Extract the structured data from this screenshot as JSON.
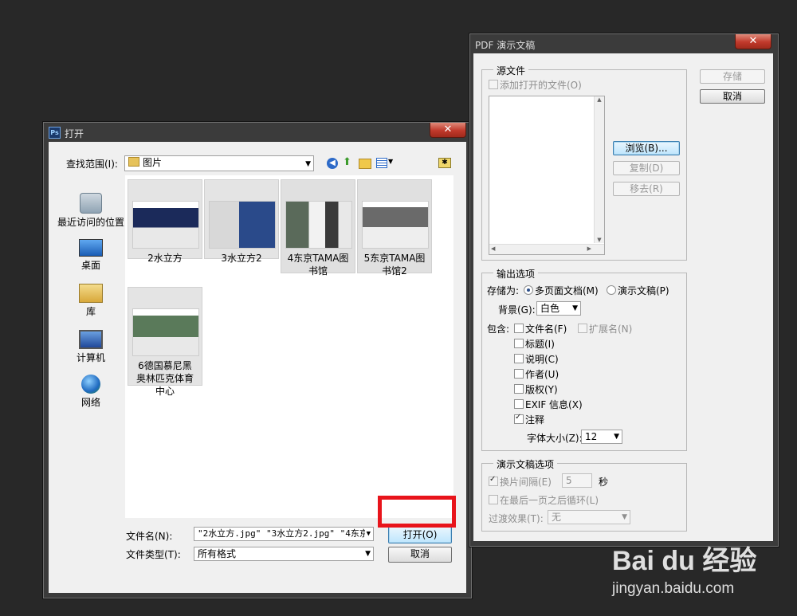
{
  "open_dialog": {
    "title": "打开",
    "close_label": "✕",
    "lookin_label": "查找范围(I):",
    "lookin_value": "图片",
    "places": [
      {
        "label": "最近访问的位置",
        "icon": "recent-places-icon"
      },
      {
        "label": "桌面",
        "icon": "desktop-icon"
      },
      {
        "label": "库",
        "icon": "library-icon"
      },
      {
        "label": "计算机",
        "icon": "computer-icon"
      },
      {
        "label": "网络",
        "icon": "network-icon"
      }
    ],
    "files": [
      {
        "name": "2水立方"
      },
      {
        "name": "3水立方2"
      },
      {
        "name": "4东京TAMA图书馆"
      },
      {
        "name": "5东京TAMA图书馆2"
      },
      {
        "name": "6德国慕尼黑奥林匹克体育中心"
      }
    ],
    "filename_label": "文件名(N):",
    "filename_value": "\"2水立方.jpg\" \"3水立方2.jpg\" \"4东京TA",
    "filetype_label": "文件类型(T):",
    "filetype_value": "所有格式",
    "open_button": "打开(O)",
    "cancel_button": "取消"
  },
  "pdf_dialog": {
    "title": "PDF 演示文稿",
    "close_label": "✕",
    "source_legend": "源文件",
    "add_open_files": "添加打开的文件(O)",
    "browse_button": "浏览(B)...",
    "duplicate_button": "复制(D)",
    "remove_button": "移去(R)",
    "save_button": "存储",
    "cancel_button": "取消",
    "output_legend": "输出选项",
    "save_as_label": "存储为:",
    "multi_page": "多页面文档(M)",
    "presentation": "演示文稿(P)",
    "background_label": "背景(G):",
    "background_value": "白色",
    "include_label": "包含:",
    "include": {
      "filename": "文件名(F)",
      "extension": "扩展名(N)",
      "title": "标题(I)",
      "description": "说明(C)",
      "author": "作者(U)",
      "copyright": "版权(Y)",
      "exif": "EXIF 信息(X)",
      "notes": "注释"
    },
    "font_size_label": "字体大小(Z):",
    "font_size_value": "12",
    "slideshow_legend": "演示文稿选项",
    "advance_label": "换片间隔(E)",
    "advance_value": "5",
    "seconds": "秒",
    "loop_label": "在最后一页之后循环(L)",
    "transition_label": "过渡效果(T):",
    "transition_value": "无"
  },
  "watermark": {
    "brand": "Bai du 经验",
    "url": "jingyan.baidu.com"
  },
  "colors": {
    "highlight_box": "#e8141b",
    "desktop_bg": "#282828"
  }
}
